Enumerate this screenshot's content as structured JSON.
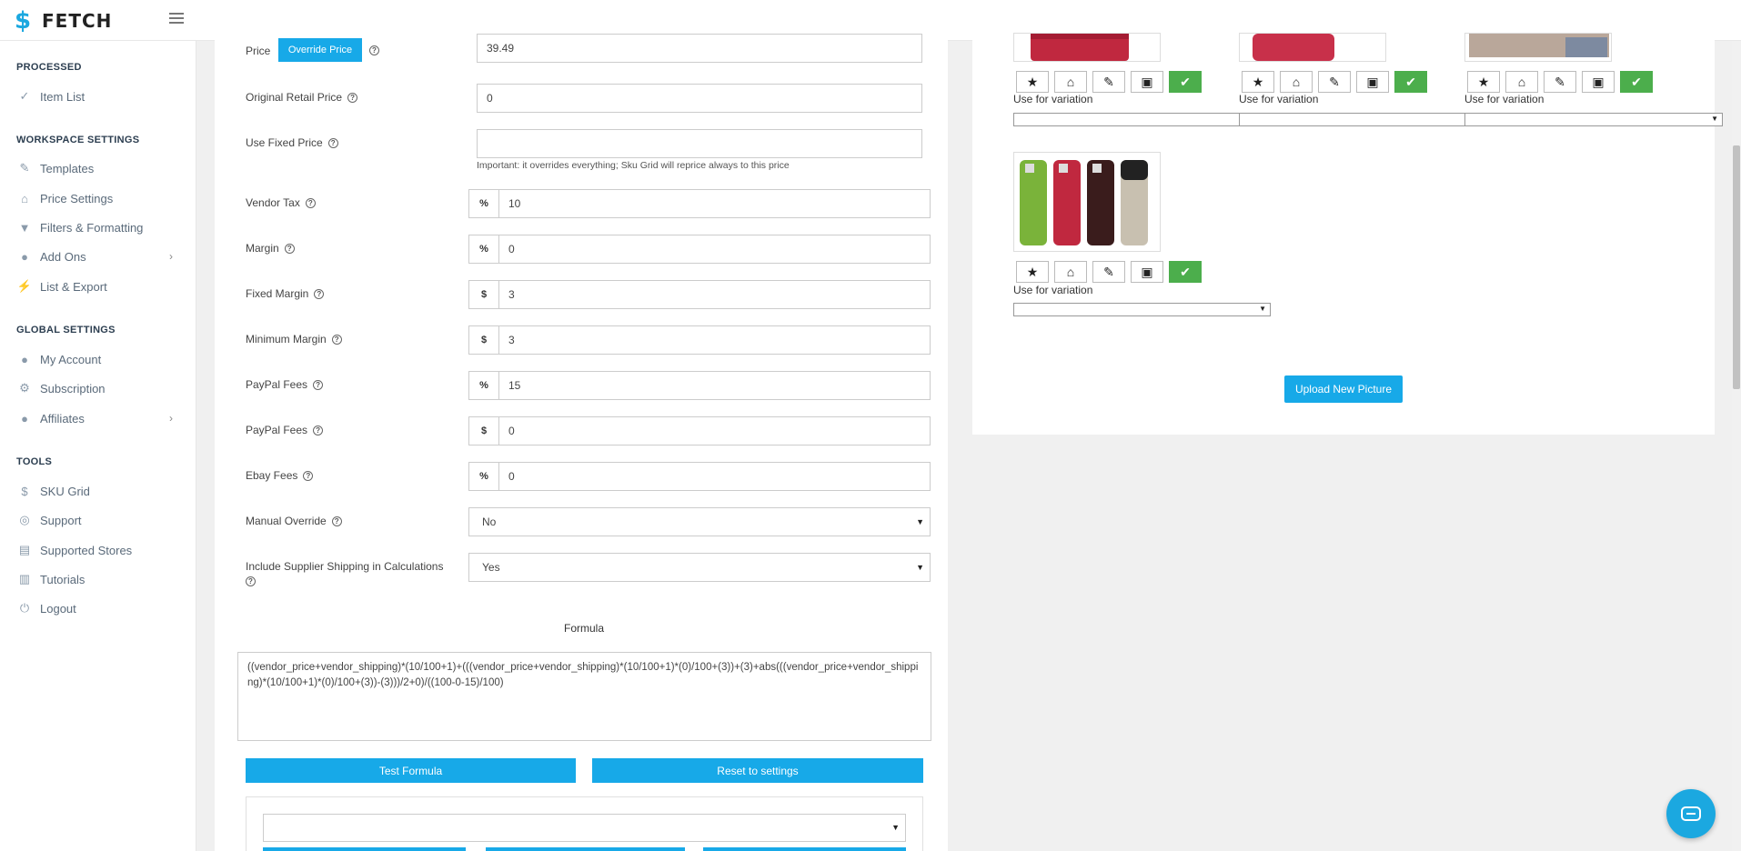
{
  "app": {
    "name": "FETCH"
  },
  "sidebar": {
    "sections": [
      {
        "title": "PROCESSED",
        "items": [
          {
            "label": "Item List",
            "icon": "check-icon"
          }
        ]
      },
      {
        "title": "WORKSPACE SETTINGS",
        "items": [
          {
            "label": "Templates",
            "icon": "brush-icon"
          },
          {
            "label": "Price Settings",
            "icon": "tags-icon"
          },
          {
            "label": "Filters & Formatting",
            "icon": "filter-icon"
          },
          {
            "label": "Add Ons",
            "icon": "user-plus-icon",
            "has_submenu": true
          },
          {
            "label": "List & Export",
            "icon": "magic-icon"
          }
        ]
      },
      {
        "title": "GLOBAL SETTINGS",
        "items": [
          {
            "label": "My Account",
            "icon": "user-icon"
          },
          {
            "label": "Subscription",
            "icon": "gear-icon"
          },
          {
            "label": "Affiliates",
            "icon": "user-plus-icon",
            "has_submenu": true
          }
        ]
      },
      {
        "title": "TOOLS",
        "items": [
          {
            "label": "SKU Grid",
            "icon": "fetch-icon"
          },
          {
            "label": "Support",
            "icon": "lifebuoy-icon"
          },
          {
            "label": "Supported Stores",
            "icon": "store-icon"
          },
          {
            "label": "Tutorials",
            "icon": "books-icon"
          },
          {
            "label": "Logout",
            "icon": "logout-icon"
          }
        ]
      }
    ]
  },
  "price_form": {
    "price": {
      "label": "Price",
      "override_label": "Override Price",
      "value": "39.49"
    },
    "original_retail": {
      "label": "Original Retail Price",
      "value": "0"
    },
    "use_fixed": {
      "label": "Use Fixed Price",
      "value": "",
      "hint": "Important: it overrides everything; Sku Grid will reprice always to this price"
    },
    "vendor_tax": {
      "label": "Vendor Tax",
      "unit": "%",
      "value": "10"
    },
    "margin": {
      "label": "Margin",
      "unit": "%",
      "value": "0"
    },
    "fixed_margin": {
      "label": "Fixed Margin",
      "unit": "$",
      "value": "3"
    },
    "minimum_margin": {
      "label": "Minimum Margin",
      "unit": "$",
      "value": "3"
    },
    "paypal_fees_pct": {
      "label": "PayPal Fees",
      "unit": "%",
      "value": "15"
    },
    "paypal_fees_fixed": {
      "label": "PayPal Fees",
      "unit": "$",
      "value": "0"
    },
    "ebay_fees": {
      "label": "Ebay Fees",
      "unit": "%",
      "value": "0"
    },
    "manual_override": {
      "label": "Manual Override",
      "value": "No"
    },
    "include_shipping": {
      "label_line1": "Include Supplier Shipping in Calculations",
      "value": "Yes"
    },
    "formula_title": "Formula",
    "formula": "((vendor_price+vendor_shipping)*(10/100+1)+(((vendor_price+vendor_shipping)*(10/100+1)*(0)/100+(3))+(3)+abs(((vendor_price+vendor_shipping)*(10/100+1)*(0)/100+(3))-(3)))/2+0)/((100-0-15)/100)",
    "test_button": "Test Formula",
    "reset_button": "Reset to settings"
  },
  "pictures": {
    "use_for_variation": "Use for variation",
    "upload_button": "Upload New Picture"
  },
  "colors": {
    "accent": "#17a9e8",
    "success": "#4cae4c"
  }
}
